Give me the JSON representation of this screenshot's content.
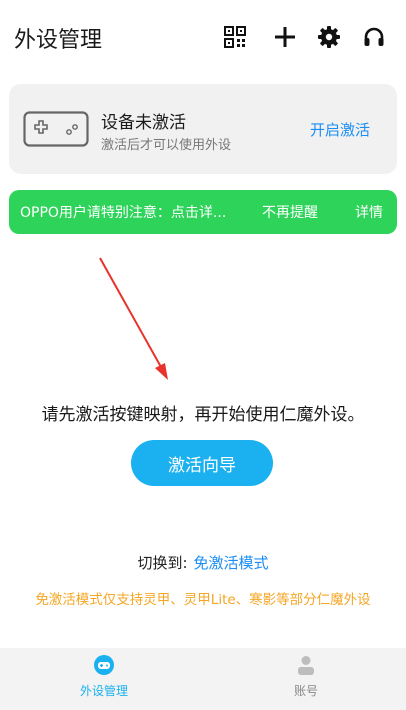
{
  "header": {
    "title": "外设管理",
    "icons": [
      "qr-code-icon",
      "plus-icon",
      "gear-icon",
      "headset-icon"
    ]
  },
  "activation_card": {
    "title": "设备未激活",
    "subtitle": "激活后才可以使用外设",
    "action_label": "开启激活",
    "icon": "gamepad-icon"
  },
  "notice": {
    "text": "OPPO用户请特别注意：点击详...",
    "dismiss_label": "不再提醒",
    "details_label": "详情",
    "color": "#2ed35a"
  },
  "main": {
    "instruction": "请先激活按键映射，再开始使用仁魔外设。",
    "guide_button": "激活向导",
    "switch_prefix": "切换到:",
    "switch_link": "免激活模式",
    "mode_note": "免激活模式仅支持灵甲、灵甲Lite、寒影等部分仁魔外设"
  },
  "bottom_nav": {
    "items": [
      {
        "label": "外设管理",
        "icon": "gamepad-icon",
        "active": true
      },
      {
        "label": "账号",
        "icon": "user-icon",
        "active": false
      }
    ]
  },
  "colors": {
    "accent": "#1bb1f0",
    "link": "#1a8ef5",
    "warning": "#f5a623",
    "notice": "#2ed35a",
    "arrow": "#e8322b"
  }
}
